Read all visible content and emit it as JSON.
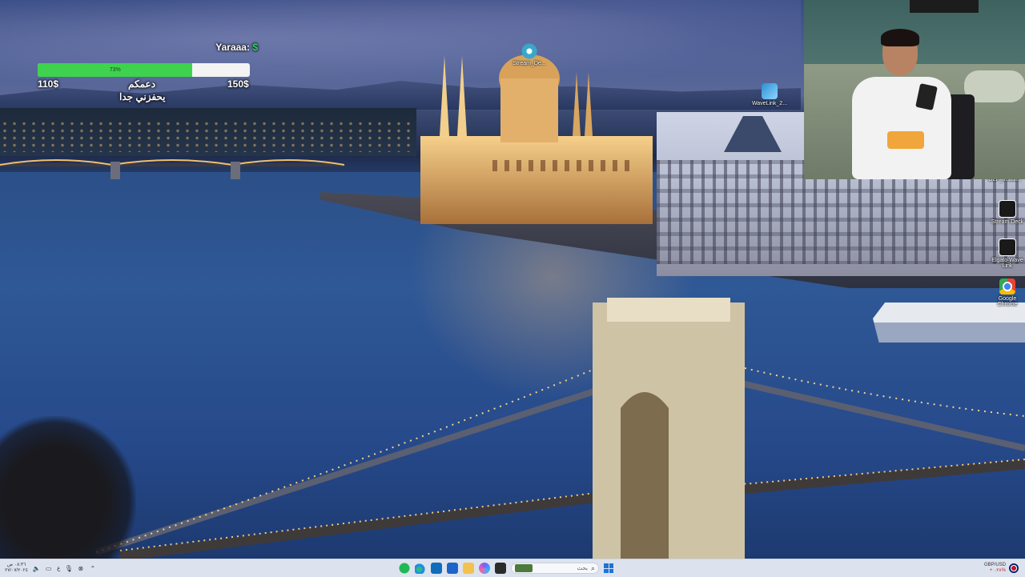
{
  "donation": {
    "title": "Yaraaa:",
    "currency_symbol": "$",
    "progress": 0.73,
    "progress_label": "73%",
    "min_label": "110$",
    "max_label": "150$",
    "line1": "دعمكم",
    "line2": "يحفزني جدا",
    "fill_color": "#3fd24f"
  },
  "desktop_icons": {
    "stream_deck_top": "Stream_De...",
    "wavelink": "WaveLink_2...",
    "glp": "GLP_install...",
    "stream_deck": "Stream Deck",
    "elgato_wave": "Elgato Wave Link",
    "chrome": "Google Chrome"
  },
  "taskbar": {
    "time": "٠٨:٣٦ ص",
    "date": "٢٧/٠٧/٢٠٢٤",
    "lang": "ع",
    "search_placeholder": "بحث",
    "ticker_symbol": "GBP/USD",
    "ticker_change": "+٠.٢٨%",
    "apps": [
      "spotify",
      "edge",
      "outlook",
      "store",
      "files",
      "copilot",
      "terminal"
    ]
  }
}
